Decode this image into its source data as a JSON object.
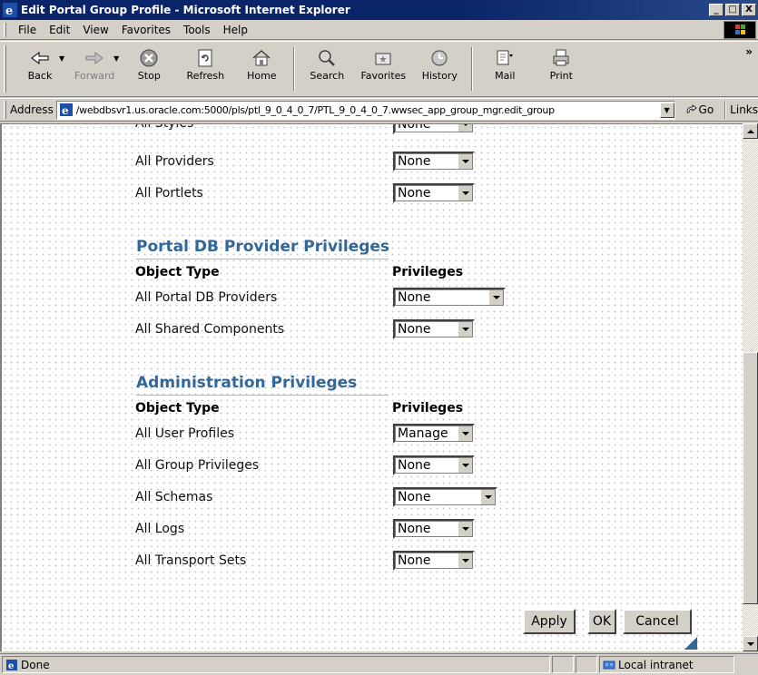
{
  "window": {
    "title": "Edit Portal Group Profile - Microsoft Internet Explorer",
    "controls": [
      "_",
      "□",
      "X"
    ]
  },
  "menu": {
    "items": [
      {
        "label": "File",
        "hotkey": "F"
      },
      {
        "label": "Edit",
        "hotkey": "E"
      },
      {
        "label": "View",
        "hotkey": "V"
      },
      {
        "label": "Favorites",
        "hotkey": "a"
      },
      {
        "label": "Tools",
        "hotkey": "T"
      },
      {
        "label": "Help",
        "hotkey": "H"
      }
    ]
  },
  "toolbar": {
    "back": "Back",
    "forward": "Forward",
    "stop": "Stop",
    "refresh": "Refresh",
    "home": "Home",
    "search": "Search",
    "favorites": "Favorites",
    "history": "History",
    "mail": "Mail",
    "print": "Print",
    "more": "»"
  },
  "address": {
    "label": "Address",
    "url": "/webdbsvr1.us.oracle.com:5000/pls/ptl_9_0_4_0_7/PTL_9_0_4_0_7.wwsec_app_group_mgr.edit_group",
    "go": "Go",
    "links": "Links"
  },
  "page": {
    "top_rows": [
      {
        "label": "All Styles",
        "value": "None"
      },
      {
        "label": "All Providers",
        "value": "None"
      },
      {
        "label": "All Portlets",
        "value": "None"
      }
    ],
    "portal_db": {
      "title": "Portal DB Provider Privileges",
      "col_object": "Object Type",
      "col_priv": "Privileges",
      "rows": [
        {
          "label": "All Portal DB Providers",
          "value": "None"
        },
        {
          "label": "All Shared Components",
          "value": "None"
        }
      ]
    },
    "admin": {
      "title": "Administration Privileges",
      "col_object": "Object Type",
      "col_priv": "Privileges",
      "rows": [
        {
          "label": "All User Profiles",
          "value": "Manage"
        },
        {
          "label": "All Group Privileges",
          "value": "None"
        },
        {
          "label": "All Schemas",
          "value": "None"
        },
        {
          "label": "All Logs",
          "value": "None"
        },
        {
          "label": "All Transport Sets",
          "value": "None"
        }
      ]
    },
    "buttons": {
      "apply": "Apply",
      "ok": "OK",
      "cancel": "Cancel"
    }
  },
  "status": {
    "text": "Done",
    "zone": "Local intranet"
  },
  "colors": {
    "titlebar": "#0a246a",
    "section_title": "#336699",
    "chrome": "#d4d0c8"
  }
}
